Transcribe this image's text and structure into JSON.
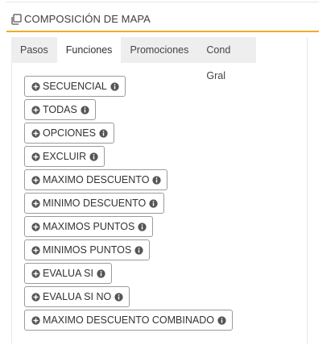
{
  "panel": {
    "icon": "copy-layers-icon",
    "title": "COMPOSICIÓN DE MAPA",
    "accent_color": "#f0ad28"
  },
  "tabs": [
    {
      "label": "Pasos",
      "active": false
    },
    {
      "label": "Funciones",
      "active": true
    },
    {
      "label": "Promociones",
      "active": false
    },
    {
      "label": "Cond Gral",
      "active": false
    }
  ],
  "functions": [
    {
      "label": "SECUENCIAL"
    },
    {
      "label": "TODAS"
    },
    {
      "label": "OPCIONES"
    },
    {
      "label": "EXCLUIR"
    },
    {
      "label": "MAXIMO DESCUENTO"
    },
    {
      "label": "MINIMO DESCUENTO"
    },
    {
      "label": "MAXIMOS PUNTOS"
    },
    {
      "label": "MINIMOS PUNTOS"
    },
    {
      "label": "EVALUA SI"
    },
    {
      "label": "EVALUA SI NO"
    },
    {
      "label": "MAXIMO DESCUENTO COMBINADO"
    }
  ],
  "icons": {
    "button_prefix": "plus-circle-icon",
    "button_suffix": "info-circle-icon"
  }
}
